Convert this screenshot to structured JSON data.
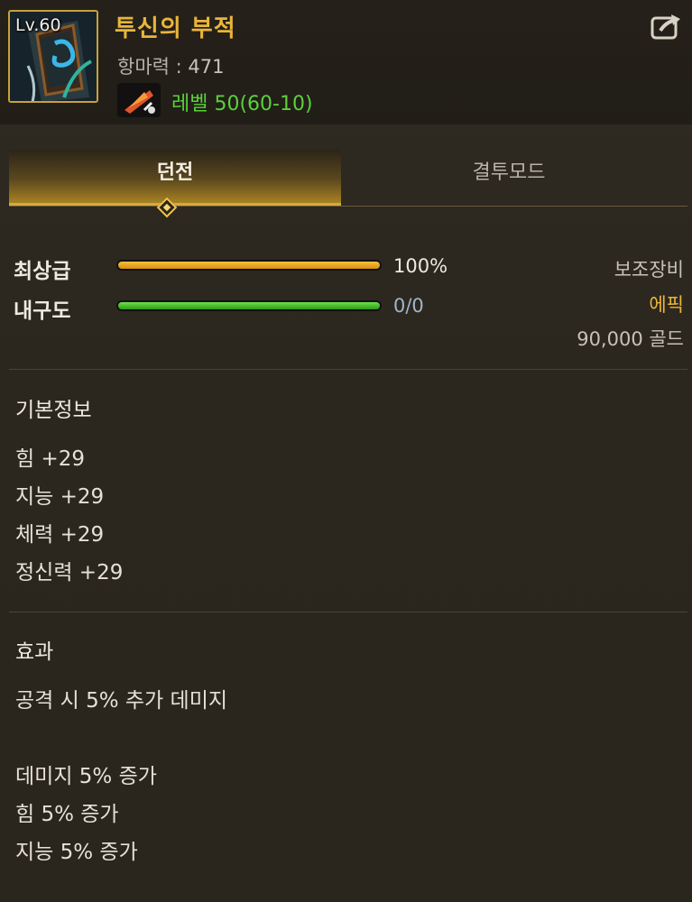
{
  "item": {
    "level_badge": "Lv.60",
    "name": "투신의 부적",
    "power_label": "항마력 : ",
    "power_value": "471",
    "level_requirement": "레벨 50(60-10)"
  },
  "tabs": [
    {
      "label": "던전",
      "active": true
    },
    {
      "label": "결투모드",
      "active": false
    }
  ],
  "bars": [
    {
      "label": "최상급",
      "value_text": "100%",
      "fill_percent": 100,
      "color": "#e0a21a"
    },
    {
      "label": "내구도",
      "value_text": "0/0",
      "fill_percent": 100,
      "color": "#3fb51f"
    }
  ],
  "info": {
    "type": "보조장비",
    "rarity": "에픽",
    "rarity_color": "#e9b53a",
    "price": "90,000 골드"
  },
  "basic_info": {
    "title": "기본정보",
    "stats": [
      "힘 +29",
      "지능 +29",
      "체력 +29",
      "정신력 +29"
    ]
  },
  "effects": {
    "title": "효과",
    "lines": [
      "공격 시 5% 추가 데미지",
      "데미지 5% 증가",
      "힘 5% 증가",
      "지능 5% 증가"
    ]
  },
  "colors": {
    "accent_gold": "#e9b53a",
    "level_green": "#5ad13a",
    "background": "#2e2a22"
  },
  "icons": {
    "share": "share-export-icon",
    "feather": "red-feather-icon"
  }
}
